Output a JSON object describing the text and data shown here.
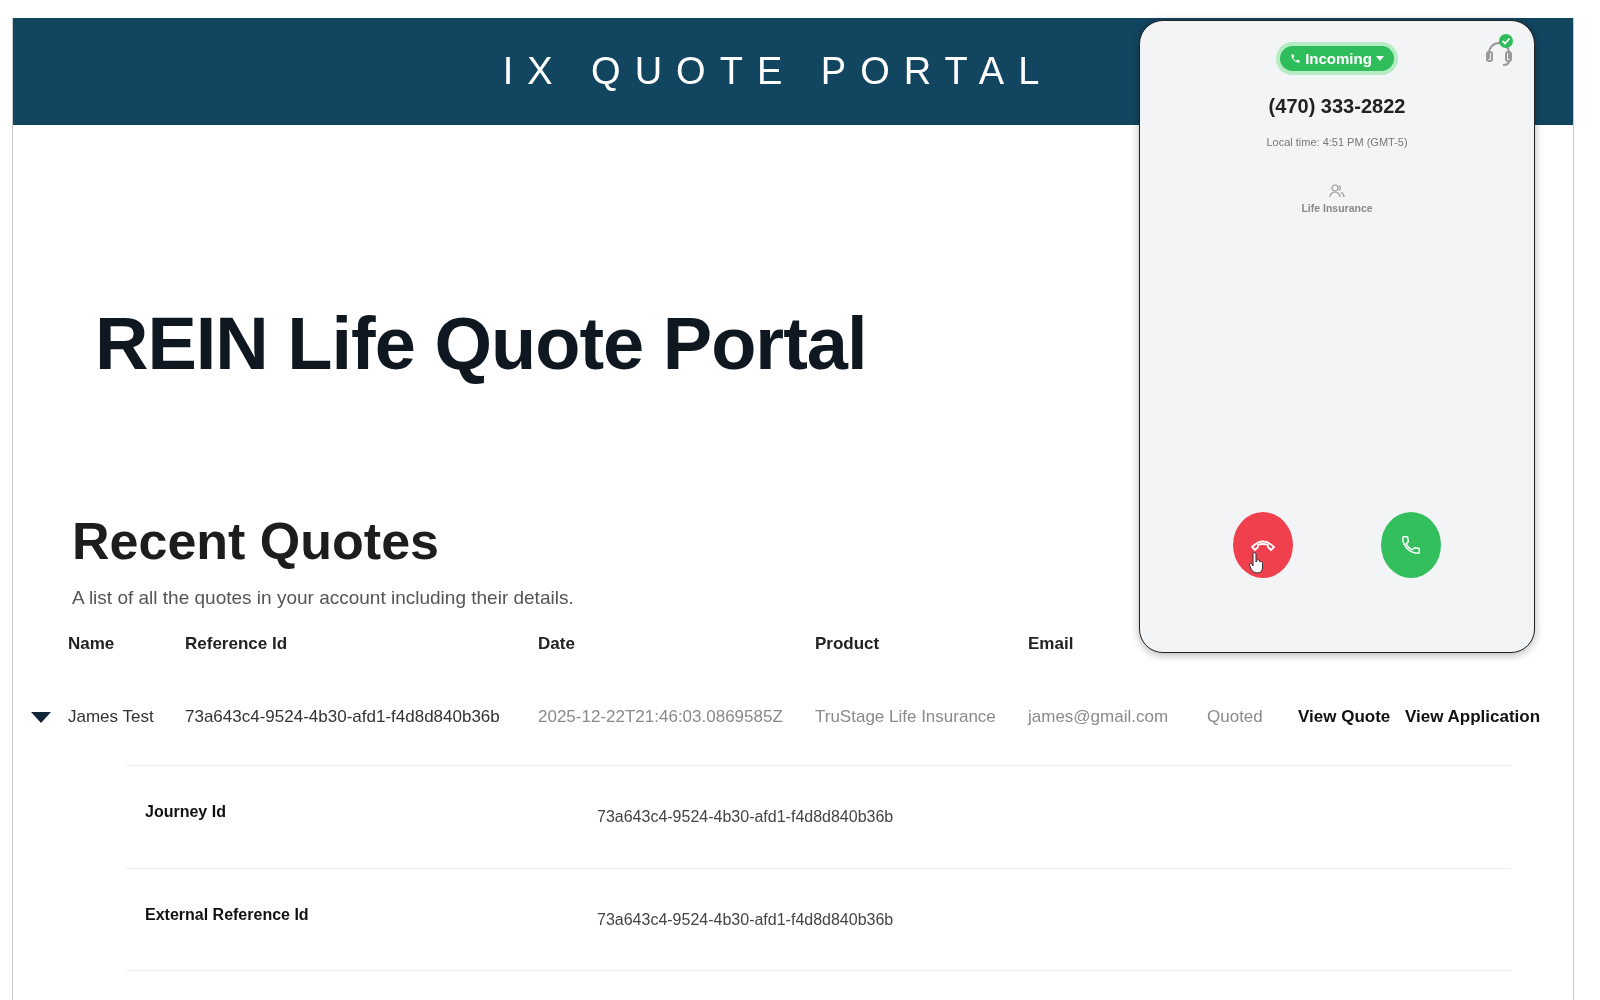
{
  "header": {
    "title": "IX QUOTE PORTAL"
  },
  "page_title": "REIN Life Quote Portal",
  "section": {
    "title": "Recent Quotes",
    "description": "A list of all the quotes in your account including their details."
  },
  "table": {
    "columns": [
      "Name",
      "Reference Id",
      "Date",
      "Product",
      "Email"
    ],
    "rows": [
      {
        "expanded": true,
        "name": "James Test",
        "reference_id": "73a643c4-9524-4b30-afd1-f4d8d840b36b",
        "date": "2025-12-22T21:46:03.0869585Z",
        "product": "TruStage Life Insurance",
        "email": "james@gmail.com",
        "status": "Quoted",
        "details_link": "View Quote",
        "application_link": "View Application",
        "details": [
          {
            "label": "Journey Id",
            "value": "73a643c4-9524-4b30-afd1-f4d8d840b36b"
          },
          {
            "label": "External Reference Id",
            "value": "73a643c4-9524-4b30-afd1-f4d8d840b36b"
          }
        ]
      }
    ]
  },
  "call_widget": {
    "status": "Incoming",
    "agent_online": true,
    "phone_number": "(470) 333-2822",
    "local_time": "Local time: 4:51 PM (GMT-5)",
    "queue": "Life Insurance"
  }
}
